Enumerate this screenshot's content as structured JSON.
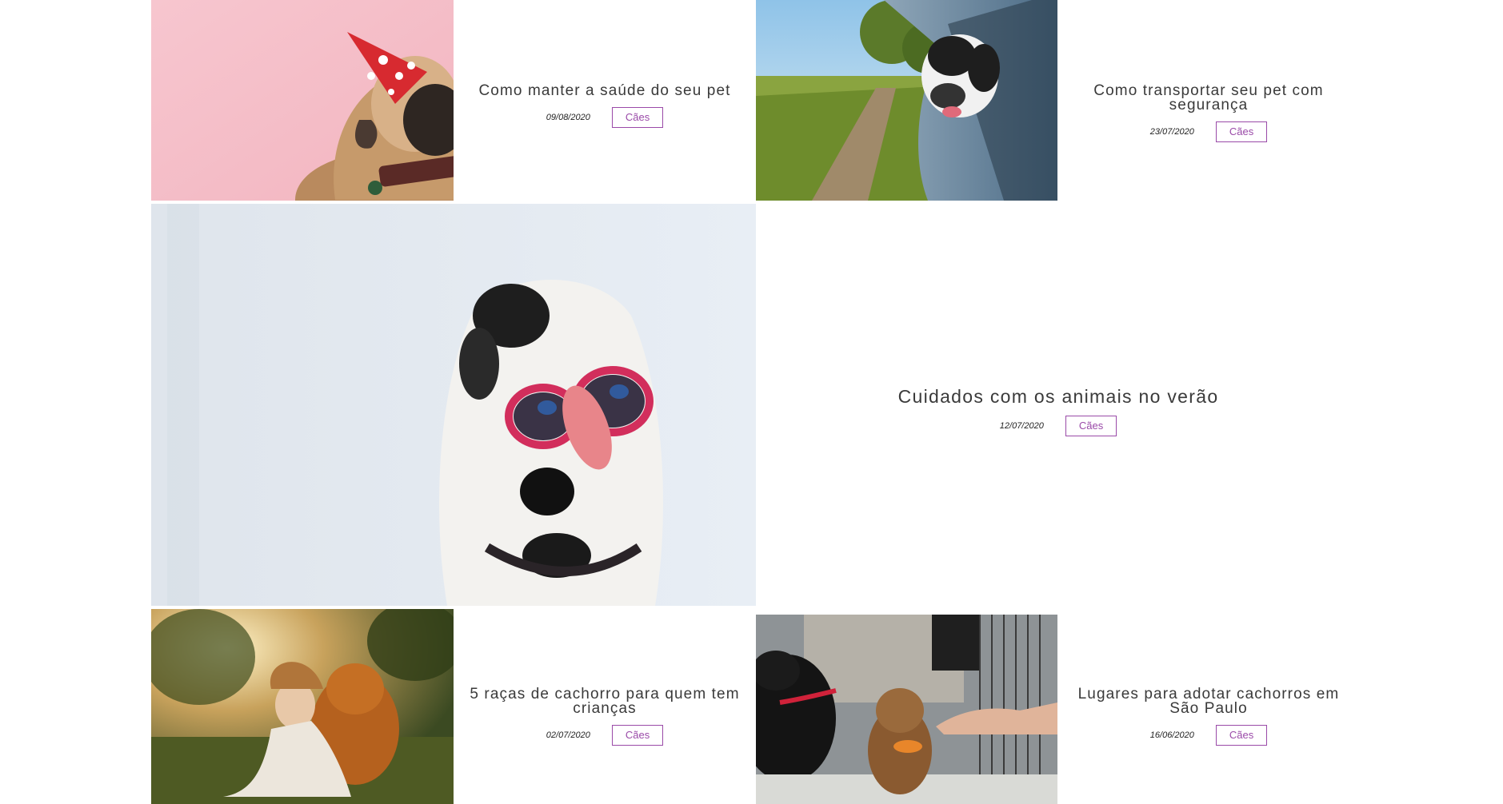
{
  "posts": [
    {
      "title": "Como manter a saúde do seu pet",
      "date": "09/08/2020",
      "category": "Cães",
      "image": "pug-party-hat-photo"
    },
    {
      "title": "Como transportar seu pet com segurança",
      "date": "23/07/2020",
      "category": "Cães",
      "image": "dog-car-window-photo"
    },
    {
      "title": "Cuidados com os animais no verão",
      "date": "12/07/2020",
      "category": "Cães",
      "image": "dog-sunglasses-photo"
    },
    {
      "title": "5 raças de cachorro para quem tem crianças",
      "date": "02/07/2020",
      "category": "Cães",
      "image": "girl-hugging-dog-photo"
    },
    {
      "title": "Lugares para adotar cachorros em São Paulo",
      "date": "16/06/2020",
      "category": "Cães",
      "image": "puppy-adoption-photo"
    }
  ],
  "colors": {
    "accent": "#9a4aa8",
    "title": "#3a3a3a",
    "background": "#ffffff"
  }
}
